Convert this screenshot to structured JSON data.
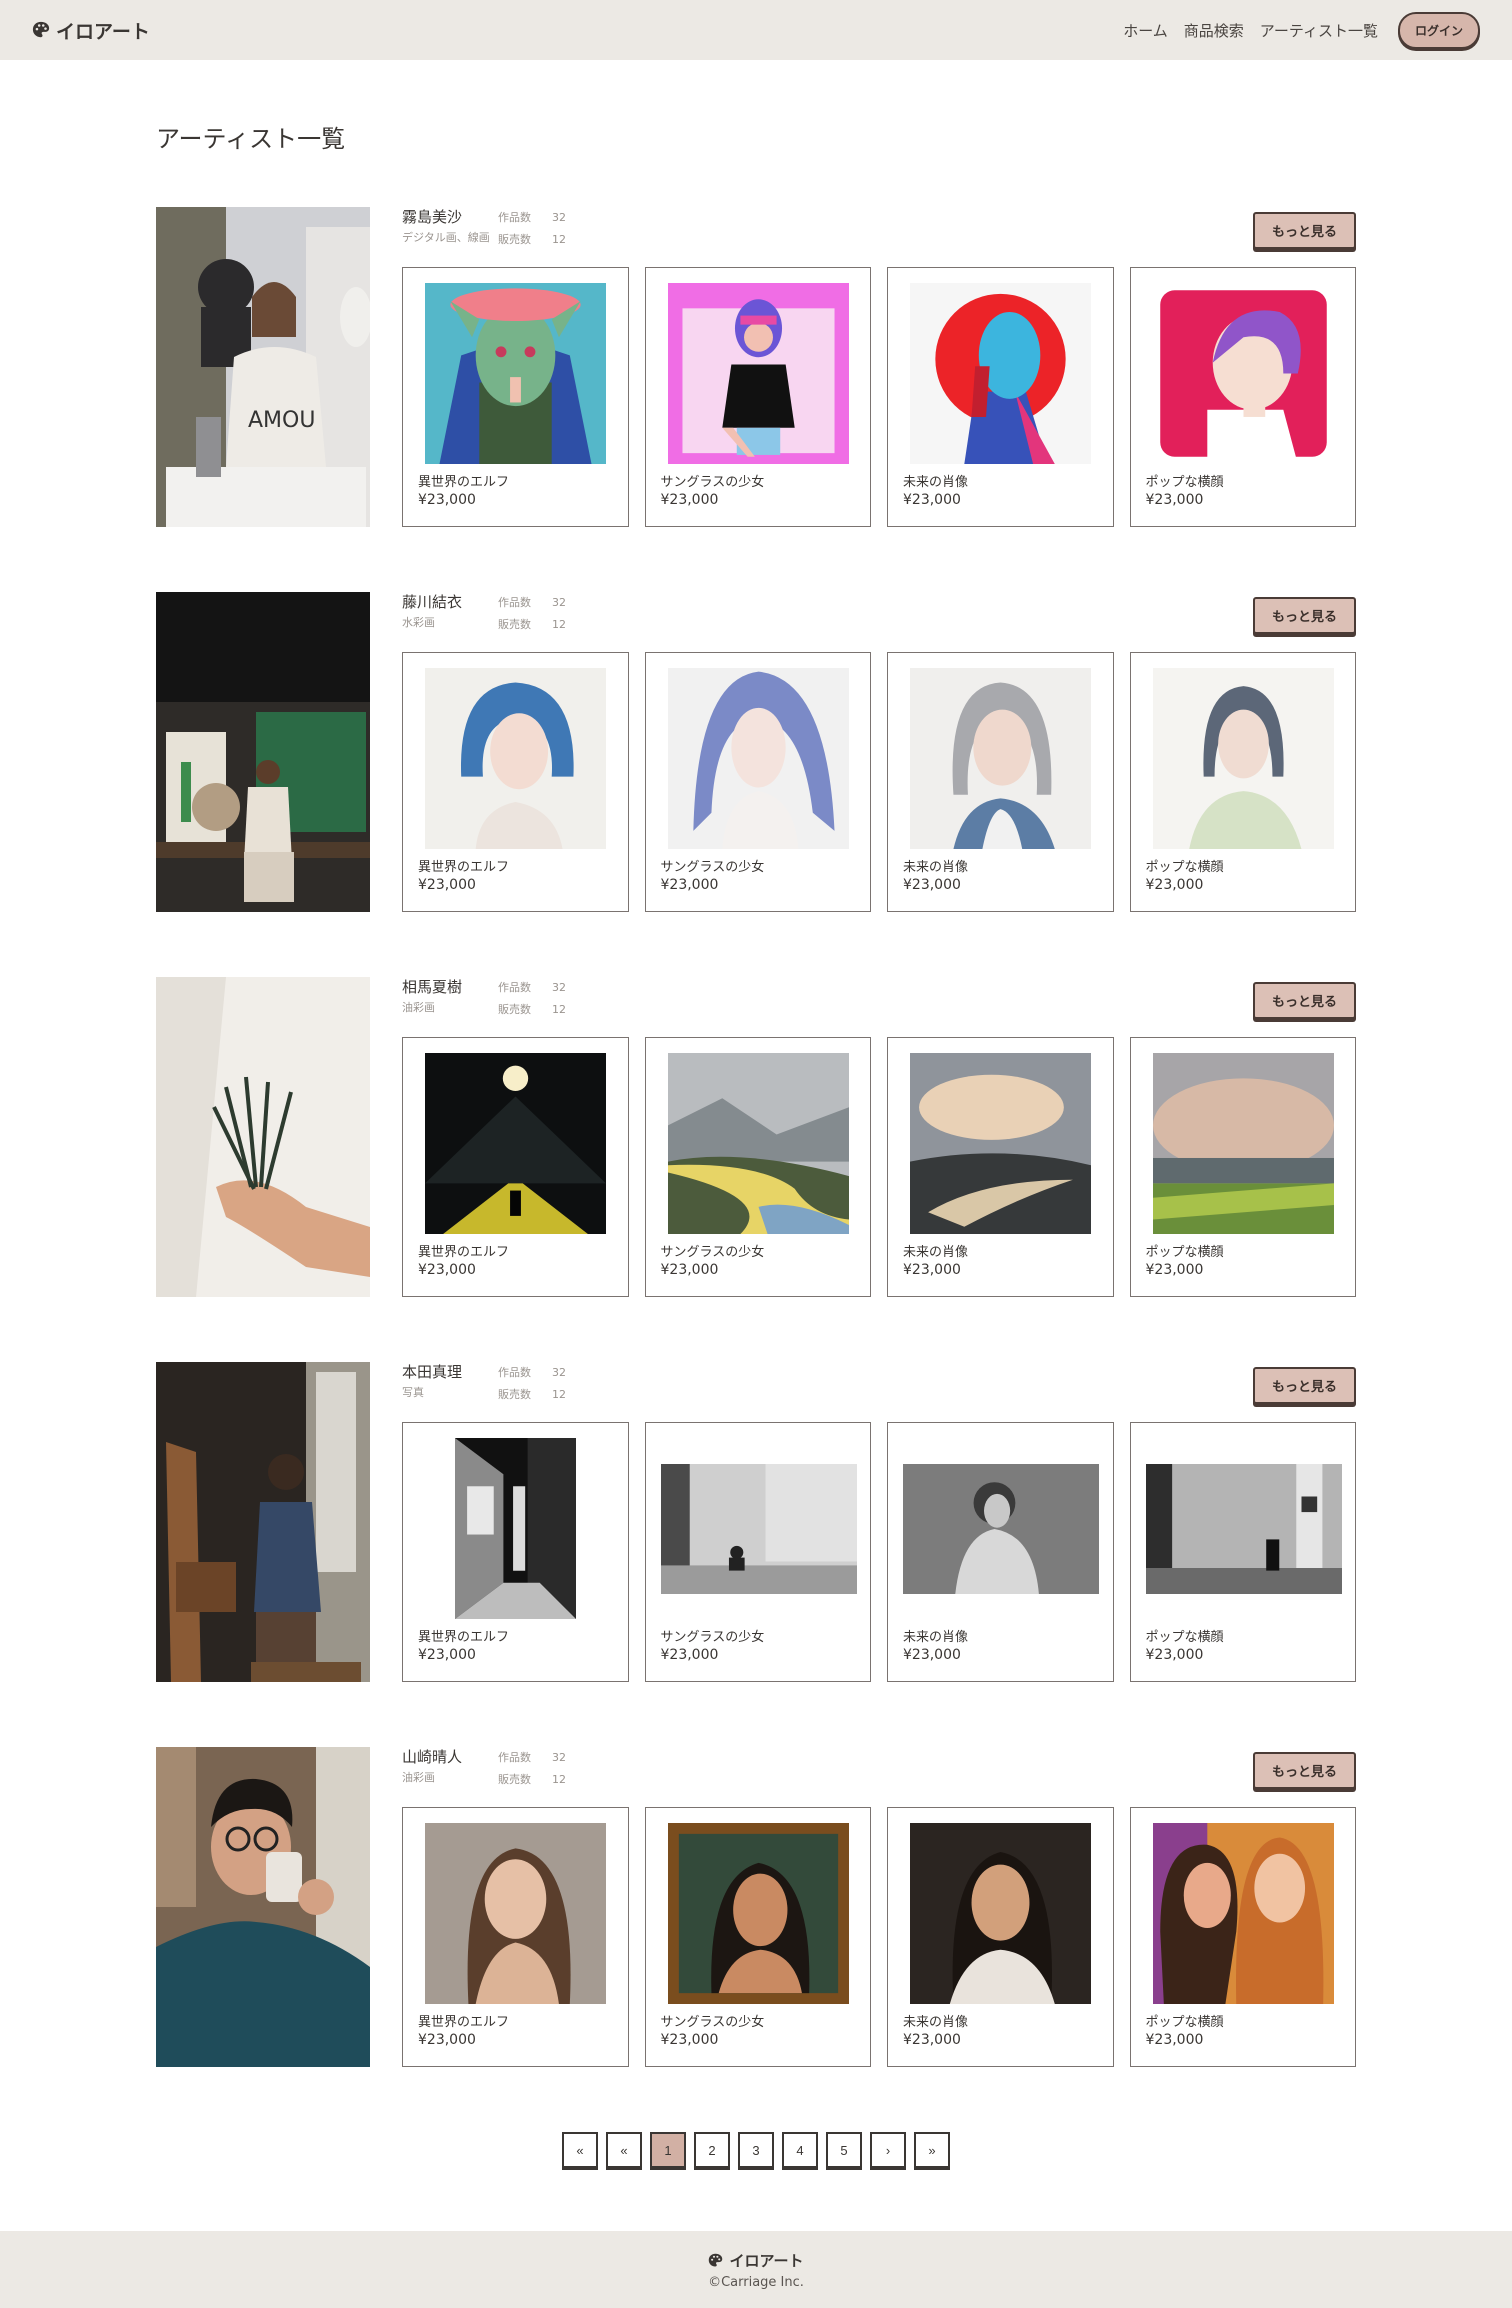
{
  "header": {
    "brand": "イロアート",
    "nav": [
      "ホーム",
      "商品検索",
      "アーティスト一覧"
    ],
    "login": "ログイン"
  },
  "page_title": "アーティスト一覧",
  "labels": {
    "works_count": "作品数",
    "sales_count": "販売数",
    "more": "もっと見る"
  },
  "artists": [
    {
      "name": "霧島美沙",
      "genre": "デジタル画、線画",
      "works": "32",
      "sales": "12",
      "items": [
        {
          "title": "異世界のエルフ",
          "price": "¥23,000"
        },
        {
          "title": "サングラスの少女",
          "price": "¥23,000"
        },
        {
          "title": "未来の肖像",
          "price": "¥23,000"
        },
        {
          "title": "ポップな横顔",
          "price": "¥23,000"
        }
      ]
    },
    {
      "name": "藤川結衣",
      "genre": "水彩画",
      "works": "32",
      "sales": "12",
      "items": [
        {
          "title": "異世界のエルフ",
          "price": "¥23,000"
        },
        {
          "title": "サングラスの少女",
          "price": "¥23,000"
        },
        {
          "title": "未来の肖像",
          "price": "¥23,000"
        },
        {
          "title": "ポップな横顔",
          "price": "¥23,000"
        }
      ]
    },
    {
      "name": "相馬夏樹",
      "genre": "油彩画",
      "works": "32",
      "sales": "12",
      "items": [
        {
          "title": "異世界のエルフ",
          "price": "¥23,000"
        },
        {
          "title": "サングラスの少女",
          "price": "¥23,000"
        },
        {
          "title": "未来の肖像",
          "price": "¥23,000"
        },
        {
          "title": "ポップな横顔",
          "price": "¥23,000"
        }
      ]
    },
    {
      "name": "本田真理",
      "genre": "写真",
      "works": "32",
      "sales": "12",
      "items": [
        {
          "title": "異世界のエルフ",
          "price": "¥23,000"
        },
        {
          "title": "サングラスの少女",
          "price": "¥23,000"
        },
        {
          "title": "未来の肖像",
          "price": "¥23,000"
        },
        {
          "title": "ポップな横顔",
          "price": "¥23,000"
        }
      ]
    },
    {
      "name": "山崎晴人",
      "genre": "油彩画",
      "works": "32",
      "sales": "12",
      "items": [
        {
          "title": "異世界のエルフ",
          "price": "¥23,000"
        },
        {
          "title": "サングラスの少女",
          "price": "¥23,000"
        },
        {
          "title": "未来の肖像",
          "price": "¥23,000"
        },
        {
          "title": "ポップな横顔",
          "price": "¥23,000"
        }
      ]
    }
  ],
  "pagination": {
    "first": "«",
    "prev": "«",
    "pages": [
      "1",
      "2",
      "3",
      "4",
      "5"
    ],
    "current": "1",
    "next": "›",
    "last": "»"
  },
  "footer": {
    "brand": "イロアート",
    "copyright": "©Carriage Inc."
  },
  "colors": {
    "header_bg": "#ece9e4",
    "button_bg": "#dcc0b6",
    "active_page": "#d2b0a4"
  }
}
